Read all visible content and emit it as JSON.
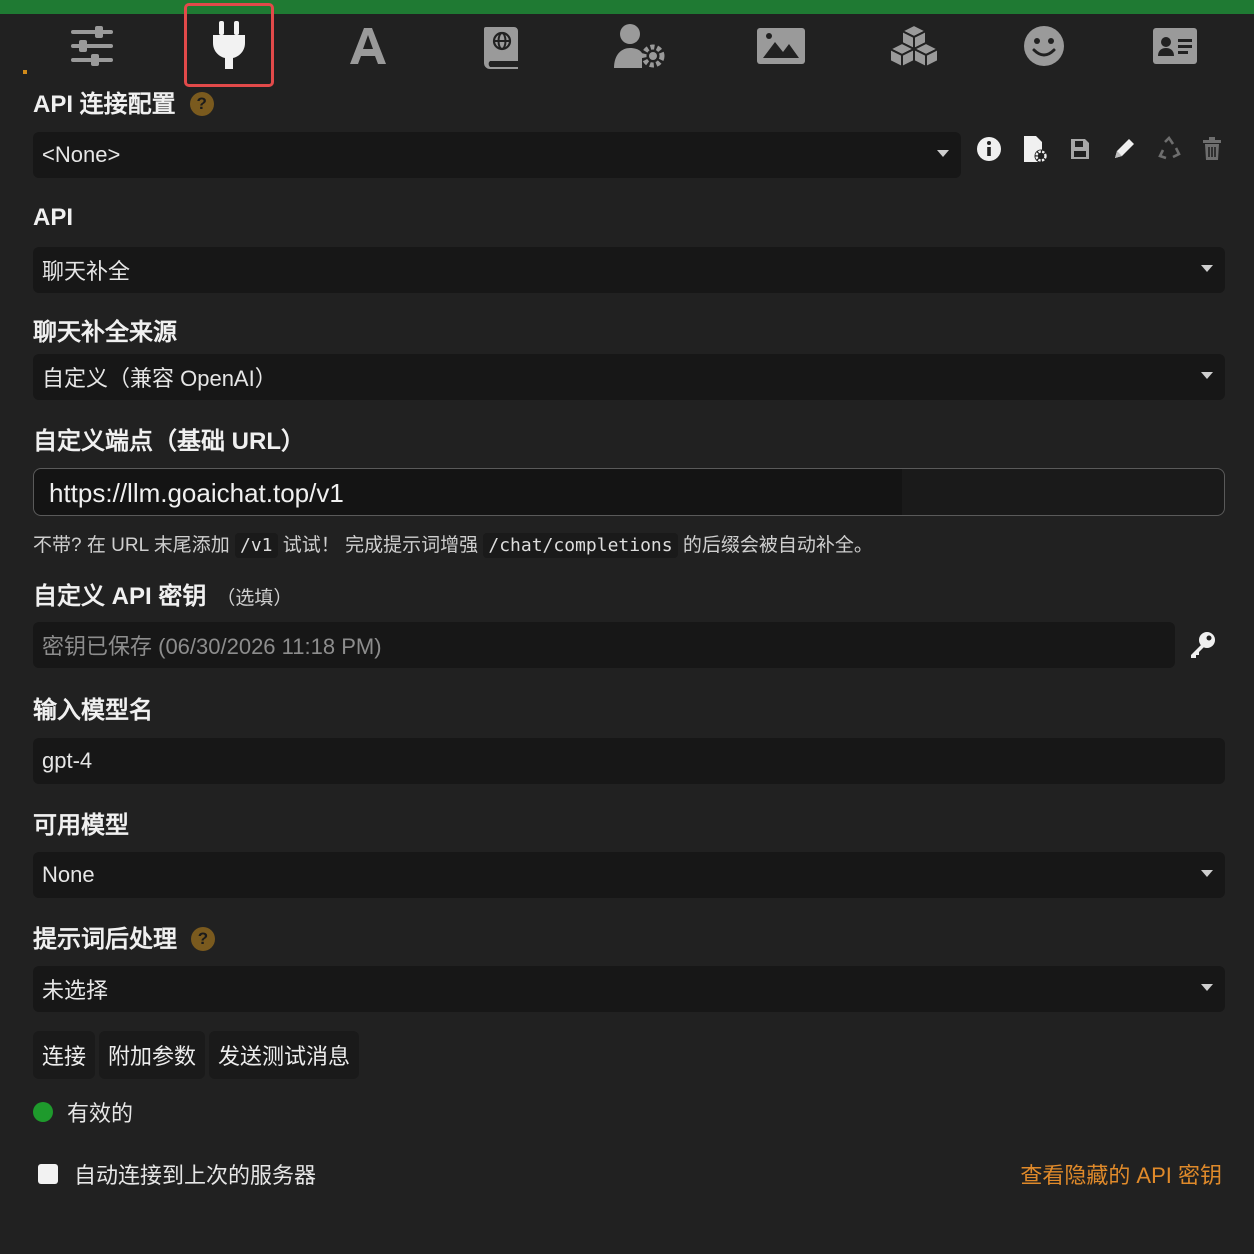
{
  "colors": {
    "accent_green": "#1f7a33",
    "active_tab_outline": "#e24a4a",
    "link_orange": "#e08a2a",
    "status_green": "#1e9a2c"
  },
  "nav": {
    "tabs": [
      {
        "icon": "sliders-icon"
      },
      {
        "icon": "plug-icon",
        "active": true
      },
      {
        "icon": "font-icon"
      },
      {
        "icon": "book-globe-icon"
      },
      {
        "icon": "user-gear-icon"
      },
      {
        "icon": "image-icon"
      },
      {
        "icon": "cubes-icon"
      },
      {
        "icon": "smile-icon"
      },
      {
        "icon": "id-card-icon"
      }
    ]
  },
  "profile": {
    "title": "API 连接配置",
    "help": "?",
    "selected": "<None>",
    "actions": [
      "info-icon",
      "file-cog-icon",
      "save-icon",
      "pencil-icon",
      "recycle-icon",
      "trash-icon"
    ]
  },
  "api": {
    "label": "API",
    "selected": "聊天补全"
  },
  "source": {
    "label": "聊天补全来源",
    "selected": "自定义（兼容 OpenAI）"
  },
  "endpoint": {
    "label": "自定义端点（基础 URL）",
    "value": "https://llm.goaichat.top/v1",
    "hint_part1": "不带? 在 URL 末尾添加",
    "hint_code1": "/v1",
    "hint_part2": "试试！ 完成提示词增强",
    "hint_code2": "/chat/completions",
    "hint_part3": "的后缀会被自动补全。"
  },
  "api_key": {
    "label": "自定义 API 密钥",
    "optional": "（选填）",
    "placeholder": "密钥已保存 (06/30/2026 11:18 PM)"
  },
  "model_input": {
    "label": "输入模型名",
    "value": "gpt-4"
  },
  "available_models": {
    "label": "可用模型",
    "selected": "None"
  },
  "post_processing": {
    "label": "提示词后处理",
    "help": "?",
    "selected": "未选择"
  },
  "buttons": {
    "connect": "连接",
    "extra_params": "附加参数",
    "send_test": "发送测试消息"
  },
  "status": {
    "text": "有效的"
  },
  "auto_connect": {
    "label": "自动连接到上次的服务器",
    "checked": false
  },
  "view_hidden_keys": "查看隐藏的 API 密钥"
}
